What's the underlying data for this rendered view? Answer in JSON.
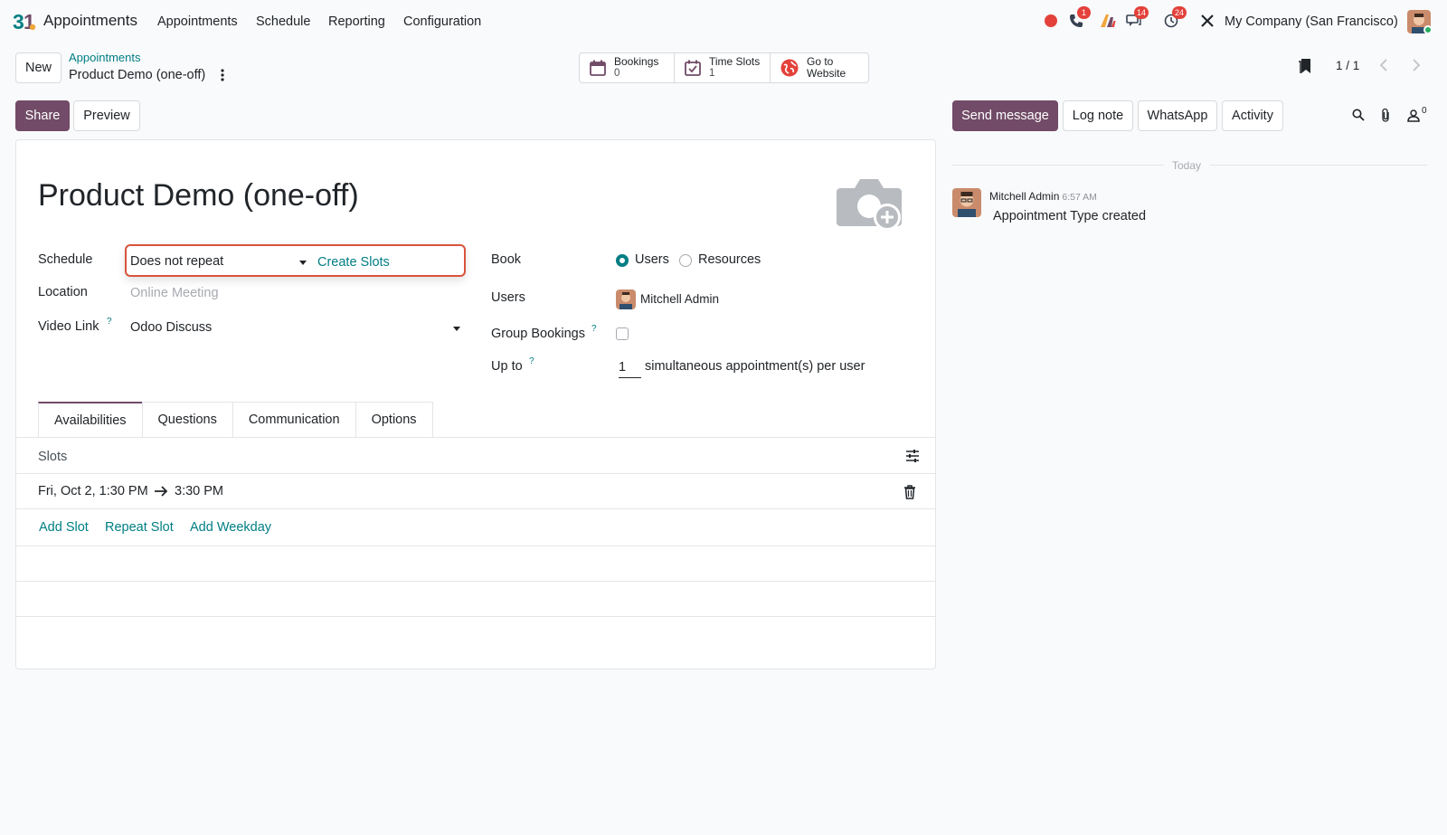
{
  "nav": {
    "app_name": "Appointments",
    "menu": [
      "Appointments",
      "Schedule",
      "Reporting",
      "Configuration"
    ],
    "badges": {
      "calls": "1",
      "messages": "14",
      "activities": "24"
    },
    "company": "My Company (San Francisco)"
  },
  "control": {
    "new_label": "New",
    "breadcrumb_parent": "Appointments",
    "breadcrumb_current": "Product Demo (one-off)",
    "stats": [
      {
        "label": "Bookings",
        "value": "0",
        "icon": "calendar-icon"
      },
      {
        "label": "Time Slots",
        "value": "1",
        "icon": "calendar-check-icon"
      },
      {
        "label": "Go to",
        "value": "Website",
        "icon": "globe-icon"
      }
    ],
    "pager": "1 / 1",
    "share_label": "Share",
    "preview_label": "Preview"
  },
  "form": {
    "title": "Product Demo (one-off)",
    "schedule_label": "Schedule",
    "schedule_value": "Does not repeat",
    "create_slots": "Create Slots",
    "location_label": "Location",
    "location_placeholder": "Online Meeting",
    "video_label": "Video Link",
    "video_value": "Odoo Discuss",
    "help_mark": "?",
    "book_label": "Book",
    "book_options": [
      "Users",
      "Resources"
    ],
    "book_selected": "Users",
    "users_label": "Users",
    "users_value": "Mitchell Admin",
    "group_label": "Group Bookings",
    "group_checked": false,
    "upto_label": "Up to",
    "upto_value": "1",
    "upto_suffix": "simultaneous appointment(s) per user"
  },
  "tabs": [
    "Availabilities",
    "Questions",
    "Communication",
    "Options"
  ],
  "slots": {
    "header": "Slots",
    "rows": [
      {
        "start": "Fri, Oct 2, 1:30 PM",
        "end": "3:30 PM"
      }
    ],
    "actions": [
      "Add Slot",
      "Repeat Slot",
      "Add Weekday"
    ]
  },
  "chatter": {
    "send_message": "Send message",
    "log_note": "Log note",
    "whatsapp": "WhatsApp",
    "activity": "Activity",
    "followers_count": "0",
    "date_sep": "Today",
    "messages": [
      {
        "author": "Mitchell Admin",
        "time": "6:57 AM",
        "body": "Appointment Type created"
      }
    ]
  },
  "colors": {
    "primary": "#714b67",
    "accent": "#017e84",
    "highlight": "#d9533b",
    "badge": "#e3413a"
  }
}
